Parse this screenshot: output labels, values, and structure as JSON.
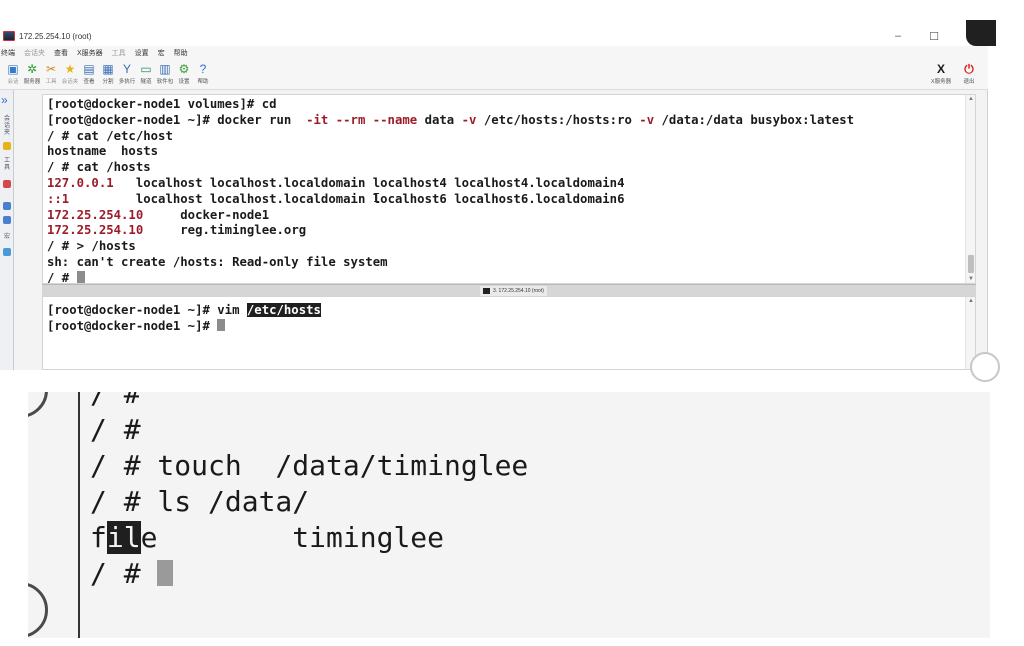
{
  "window": {
    "title": "172.25.254.10 (root)",
    "minimize": "–",
    "maximize": "☐",
    "close": "✕"
  },
  "menu": [
    {
      "label": "终端",
      "dim": false
    },
    {
      "label": "会话夹",
      "dim": true
    },
    {
      "label": "查看",
      "dim": false
    },
    {
      "label": "X服务器",
      "dim": false
    },
    {
      "label": "工具",
      "dim": true
    },
    {
      "label": "设置",
      "dim": false
    },
    {
      "label": "宏",
      "dim": false
    },
    {
      "label": "帮助",
      "dim": false
    }
  ],
  "toolbar": [
    {
      "label": "会话",
      "icon": "session-icon",
      "glyph": "▣",
      "color": "#3a78c9",
      "dim": true
    },
    {
      "label": "服务器",
      "icon": "server-icon",
      "glyph": "✲",
      "color": "#2aa12a",
      "dim": false
    },
    {
      "label": "工具",
      "icon": "tools-icon",
      "glyph": "✂",
      "color": "#c88a1a",
      "dim": true
    },
    {
      "label": "会话夹",
      "icon": "star-icon",
      "glyph": "★",
      "color": "#e8b21c",
      "dim": true
    },
    {
      "label": "查看",
      "icon": "view-icon",
      "glyph": "▤",
      "color": "#3b6fb6",
      "dim": false
    },
    {
      "label": "分割",
      "icon": "split-icon",
      "glyph": "▦",
      "color": "#3b6fb6",
      "dim": false
    },
    {
      "label": "多执行",
      "icon": "multiexec-icon",
      "glyph": "Y",
      "color": "#3b6fb6",
      "dim": false
    },
    {
      "label": "隧道",
      "icon": "tunnel-icon",
      "glyph": "▭",
      "color": "#2d8a5a",
      "dim": false
    },
    {
      "label": "软件包",
      "icon": "package-icon",
      "glyph": "▥",
      "color": "#3b6fb6",
      "dim": false
    },
    {
      "label": "设置",
      "icon": "settings-icon",
      "glyph": "⚙",
      "color": "#3a9a3a",
      "dim": false
    },
    {
      "label": "帮助",
      "icon": "help-icon",
      "glyph": "?",
      "color": "#2f6fd6",
      "dim": false
    }
  ],
  "toolbar_right": [
    {
      "label": "X服务器",
      "icon": "x-server-icon",
      "glyph": "X",
      "color": "#1a1a1a"
    },
    {
      "label": "退出",
      "icon": "power-icon",
      "glyph": "⏻",
      "color": "#d62020"
    }
  ],
  "sidebar": {
    "chevron": "»",
    "items": [
      "会话夹",
      "工具",
      "宏"
    ]
  },
  "pane_tab": "3. 172.25.254.10 (root)",
  "terminal1": [
    [
      {
        "t": "[root@docker-node1 volumes]# cd",
        "c": "plain"
      }
    ],
    [
      {
        "t": "[root@docker-node1 ~]# docker run  ",
        "c": "plain"
      },
      {
        "t": "-it --rm --name",
        "c": "red"
      },
      {
        "t": " data ",
        "c": "plain"
      },
      {
        "t": "-v",
        "c": "red"
      },
      {
        "t": " /etc/hosts:/hosts:ro ",
        "c": "plain"
      },
      {
        "t": "-v",
        "c": "red"
      },
      {
        "t": " /data:/data busybox:latest",
        "c": "plain"
      }
    ],
    [
      {
        "t": "/ # cat /etc/host",
        "c": "plain"
      }
    ],
    [
      {
        "t": "hostname  hosts",
        "c": "plain"
      }
    ],
    [
      {
        "t": "/ # cat /hosts",
        "c": "plain"
      }
    ],
    [
      {
        "t": "127.0.0.1",
        "c": "red"
      },
      {
        "t": "   localhost localhost",
        "c": "plain"
      },
      {
        "t": ".localdomain localhost4 localhost4.localdomain4",
        "c": "plain"
      }
    ],
    [
      {
        "t": "::1",
        "c": "red"
      },
      {
        "t": "         localhost localhost",
        "c": "plain"
      },
      {
        "t": ".localdomain localhost6 localhost6.localdomain6",
        "c": "plain"
      }
    ],
    [
      {
        "t": "172.25.254.10",
        "c": "red"
      },
      {
        "t": "     docker-node1",
        "c": "plain"
      }
    ],
    [
      {
        "t": "172.25.254.10",
        "c": "red"
      },
      {
        "t": "     reg.timinglee.org",
        "c": "plain"
      }
    ],
    [
      {
        "t": "/ # > /hosts",
        "c": "plain"
      }
    ],
    [
      {
        "t": "sh: can't create /hosts: Read-only file system",
        "c": "plain"
      }
    ],
    [
      {
        "t": "/ # ",
        "c": "plain"
      },
      {
        "t": "",
        "c": "cursor"
      }
    ]
  ],
  "terminal2": [
    [
      {
        "t": "[root@docker-node1 ~]# vim ",
        "c": "plain"
      },
      {
        "t": "/etc/hosts",
        "c": "sel"
      }
    ],
    [
      {
        "t": "[root@docker-node1 ~]# ",
        "c": "plain"
      },
      {
        "t": "",
        "c": "cursor"
      }
    ]
  ],
  "zoom": [
    [
      {
        "t": "/ #",
        "c": "plain"
      }
    ],
    [
      {
        "t": "/ #",
        "c": "plain"
      }
    ],
    [
      {
        "t": "/ # touch  /data/timinglee",
        "c": "plain"
      }
    ],
    [
      {
        "t": "/ # ls /data/",
        "c": "plain"
      }
    ],
    [
      {
        "t": "f",
        "c": "plain"
      },
      {
        "t": "il",
        "c": "sel"
      },
      {
        "t": "e        timinglee",
        "c": "plain"
      }
    ],
    [
      {
        "t": "/ # ",
        "c": "plain"
      },
      {
        "t": "",
        "c": "cursor"
      }
    ]
  ],
  "colors": {
    "prompt_red": "#9c1d2a",
    "cursor_gray": "#8c8c8c",
    "accent_blue": "#2f6fd6"
  }
}
